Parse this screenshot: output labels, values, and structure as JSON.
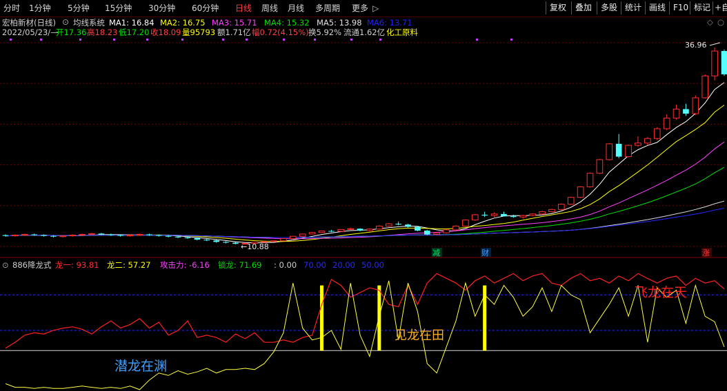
{
  "toolbar": {
    "periods": [
      "分时",
      "1分钟",
      "5分钟",
      "15分钟",
      "30分钟",
      "60分钟",
      "日线",
      "周线",
      "月线",
      "多周期",
      "更多"
    ],
    "active_period": "日线",
    "more_arrow": "▷",
    "right_buttons": [
      "复权",
      "叠加",
      "多股",
      "统计",
      "画线",
      "F10",
      "标记",
      "+自"
    ]
  },
  "main_panel": {
    "stock_title": "宏柏新材(日线)",
    "indicator_name": "均线系统",
    "ma": [
      {
        "label": "MA1: 16.84",
        "color": "#ffffff"
      },
      {
        "label": "MA2: 16.75",
        "color": "#ffff00"
      },
      {
        "label": "MA3: 15.71",
        "color": "#ff40ff"
      },
      {
        "label": "MA4: 15.32",
        "color": "#00e000"
      },
      {
        "label": "MA5: 13.98",
        "color": "#e0e0e0"
      },
      {
        "label": "MA6: 13.71",
        "color": "#2020ff"
      }
    ],
    "quote": {
      "date": "2022/05/23/—",
      "open": "开17.36",
      "high": "高18.23",
      "low": "低17.20",
      "close": "收18.09",
      "volume": "量95793",
      "amount": "额1.71亿",
      "change": "幅0.72(4.15%)",
      "turnover": "换5.92%",
      "float": "流通1.62亿",
      "sector": "化工原料"
    },
    "high_label": "36.96",
    "low_label": "←10.88",
    "markers": [
      "减",
      "财",
      "涨"
    ],
    "colors": {
      "up": "#ff3030",
      "down": "#54ffff",
      "ma1": "#ffffff",
      "ma2": "#ffff00",
      "ma3": "#ff40ff",
      "ma4": "#00e000",
      "ma5": "#d8d8d8",
      "ma6": "#2828ff"
    }
  },
  "sub_panel": {
    "indicator": "886降龙式",
    "long1": "龙一: 93.81",
    "long2": "龙二: 57.27",
    "attack": "攻击力: -6.16",
    "lock": "锁龙: 71.69",
    "blank": ": 0.00",
    "level70": "70.00",
    "level20": "20.00",
    "level50": "50.00",
    "annotations": {
      "qianlong": "潜龙在渊",
      "jianlong": "见龙在田",
      "feilong": "飞龙在天"
    }
  },
  "chart_data": {
    "type": "candlestick",
    "candles": [
      [
        12.1,
        12.2,
        11.9,
        12.0
      ],
      [
        12.0,
        12.2,
        11.9,
        12.1
      ],
      [
        12.1,
        12.3,
        12.0,
        12.2
      ],
      [
        12.2,
        12.3,
        12.0,
        12.1
      ],
      [
        12.1,
        12.2,
        11.9,
        12.0
      ],
      [
        12.0,
        12.1,
        11.8,
        11.9
      ],
      [
        11.9,
        12.1,
        11.8,
        12.0
      ],
      [
        12.0,
        12.2,
        11.9,
        12.1
      ],
      [
        12.1,
        12.3,
        12.0,
        12.2
      ],
      [
        12.2,
        12.4,
        12.1,
        12.3
      ],
      [
        12.3,
        12.4,
        12.1,
        12.2
      ],
      [
        12.2,
        12.3,
        12.0,
        12.1
      ],
      [
        12.1,
        12.2,
        11.9,
        12.0
      ],
      [
        12.0,
        12.2,
        11.9,
        12.1
      ],
      [
        12.1,
        12.3,
        12.0,
        12.2
      ],
      [
        12.2,
        12.3,
        12.0,
        12.1
      ],
      [
        12.1,
        12.2,
        11.9,
        12.0
      ],
      [
        12.0,
        12.1,
        11.8,
        11.9
      ],
      [
        11.9,
        12.0,
        11.7,
        11.8
      ],
      [
        11.8,
        11.9,
        11.6,
        11.7
      ],
      [
        11.7,
        11.8,
        11.4,
        11.5
      ],
      [
        11.5,
        11.6,
        11.3,
        11.4
      ],
      [
        11.4,
        11.5,
        11.1,
        11.2
      ],
      [
        11.2,
        11.3,
        11.0,
        11.1
      ],
      [
        11.1,
        11.2,
        10.88,
        10.95
      ],
      [
        10.95,
        11.1,
        10.9,
        11.0
      ],
      [
        11.0,
        11.2,
        10.95,
        11.15
      ],
      [
        11.15,
        11.3,
        11.1,
        11.25
      ],
      [
        11.25,
        11.4,
        11.2,
        11.35
      ],
      [
        11.35,
        11.7,
        11.3,
        11.65
      ],
      [
        11.65,
        12.0,
        11.6,
        11.95
      ],
      [
        11.95,
        12.3,
        11.9,
        12.25
      ],
      [
        12.25,
        12.5,
        12.2,
        12.45
      ],
      [
        12.45,
        12.7,
        12.4,
        12.65
      ],
      [
        12.65,
        12.8,
        12.5,
        12.6
      ],
      [
        12.6,
        12.9,
        12.5,
        12.85
      ],
      [
        12.85,
        13.1,
        12.8,
        12.95
      ],
      [
        12.95,
        13.0,
        12.6,
        12.7
      ],
      [
        12.7,
        13.0,
        12.6,
        12.9
      ],
      [
        12.9,
        13.4,
        12.8,
        13.3
      ],
      [
        13.3,
        13.7,
        13.2,
        13.6
      ],
      [
        13.6,
        13.9,
        13.4,
        13.5
      ],
      [
        13.5,
        13.6,
        13.1,
        13.2
      ],
      [
        13.2,
        13.3,
        12.6,
        12.7
      ],
      [
        12.7,
        12.8,
        12.1,
        12.2
      ],
      [
        12.2,
        12.5,
        12.1,
        12.4
      ],
      [
        12.4,
        12.9,
        12.3,
        12.8
      ],
      [
        12.8,
        13.4,
        12.7,
        13.3
      ],
      [
        13.3,
        14.2,
        13.2,
        14.1
      ],
      [
        14.1,
        14.9,
        14.0,
        14.8
      ],
      [
        14.8,
        15.2,
        14.5,
        14.7
      ],
      [
        14.7,
        15.1,
        14.5,
        14.9
      ],
      [
        14.9,
        15.2,
        14.6,
        14.6
      ],
      [
        14.6,
        14.8,
        14.4,
        14.5
      ],
      [
        14.5,
        14.8,
        14.3,
        14.7
      ],
      [
        14.7,
        15.0,
        14.6,
        14.9
      ],
      [
        14.9,
        15.3,
        14.8,
        15.2
      ],
      [
        15.2,
        15.6,
        15.1,
        15.5
      ],
      [
        15.5,
        16.3,
        15.4,
        16.2
      ],
      [
        16.2,
        17.2,
        16.1,
        17.1
      ],
      [
        17.1,
        18.6,
        17.0,
        18.5
      ],
      [
        18.5,
        20.4,
        18.4,
        20.3
      ],
      [
        20.3,
        22.2,
        20.2,
        22.1
      ],
      [
        22.1,
        24.3,
        22.0,
        24.2
      ],
      [
        24.2,
        25.5,
        22.3,
        22.5
      ],
      [
        22.5,
        24.1,
        22.4,
        24.0
      ],
      [
        24.0,
        25.2,
        23.8,
        24.3
      ],
      [
        24.3,
        25.1,
        24.0,
        24.9
      ],
      [
        24.9,
        26.4,
        24.7,
        26.2
      ],
      [
        26.2,
        28.1,
        26.0,
        27.6
      ],
      [
        27.6,
        29.4,
        27.4,
        28.8
      ],
      [
        28.8,
        29.5,
        27.9,
        28.2
      ],
      [
        28.2,
        30.6,
        28.0,
        30.3
      ],
      [
        30.3,
        33.4,
        30.2,
        33.2
      ],
      [
        33.2,
        36.96,
        32.6,
        36.5
      ],
      [
        36.5,
        36.7,
        33.2,
        33.4
      ]
    ],
    "ylim": [
      10.6,
      37.6
    ],
    "sub_series": {
      "long1": [
        35,
        40,
        46,
        48,
        47,
        50,
        52,
        53,
        51,
        47,
        53,
        58,
        52,
        55,
        60,
        52,
        57,
        46,
        50,
        58,
        44,
        46,
        44,
        40,
        47,
        43,
        48,
        40,
        40,
        42,
        40,
        44,
        46,
        72,
        93,
        88,
        78,
        82,
        86,
        84,
        72,
        70,
        88,
        72,
        90,
        98,
        94,
        90,
        84,
        92,
        96,
        90,
        94,
        98,
        92,
        96,
        98,
        90,
        88,
        94,
        98,
        92,
        94,
        90,
        96,
        92,
        98,
        93.81,
        90,
        94,
        96,
        88,
        94,
        90,
        92,
        85
      ],
      "long2": [
        5,
        2,
        2,
        1,
        2,
        1,
        1,
        2,
        3,
        2,
        1,
        2,
        1,
        3,
        0,
        8,
        14,
        12,
        16,
        13,
        15,
        18,
        14,
        17,
        17,
        18,
        17,
        22,
        32,
        48,
        90,
        52,
        42,
        44,
        50,
        34,
        90,
        46,
        28,
        62,
        92,
        42,
        90,
        66,
        22,
        14,
        36,
        58,
        90,
        62,
        80,
        72,
        88,
        78,
        62,
        70,
        86,
        66,
        88,
        80,
        76,
        48,
        60,
        72,
        86,
        62,
        88,
        40,
        86,
        78,
        84,
        56,
        88,
        62,
        57.27,
        36
      ]
    },
    "yellow_bar_indices": [
      33,
      39,
      50
    ]
  }
}
